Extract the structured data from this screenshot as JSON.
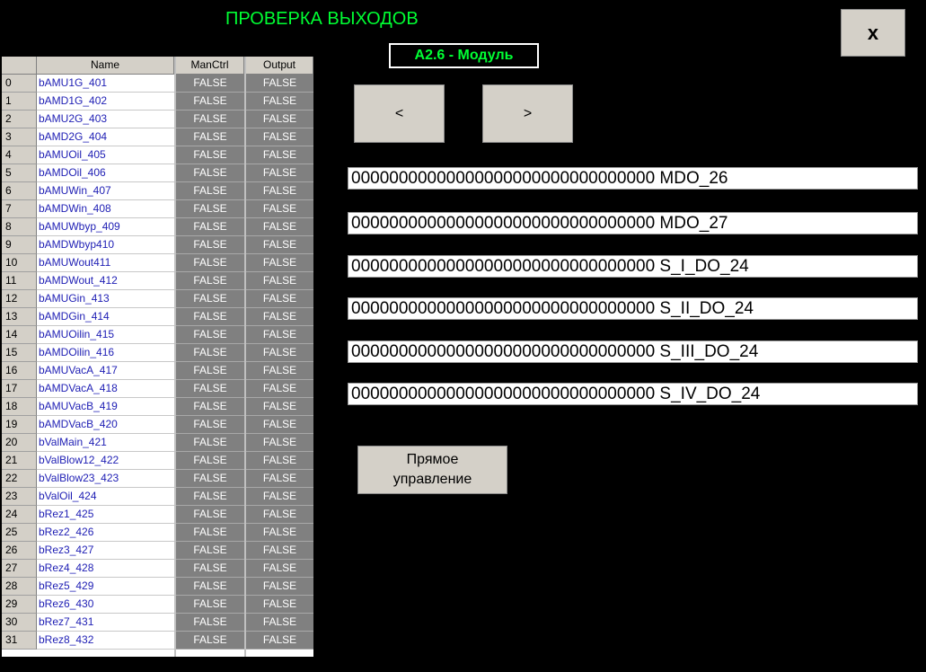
{
  "header": {
    "title": "ПРОВЕРКА ВЫХОДОВ",
    "close_label": "x"
  },
  "module": {
    "label": "A2.6 - Модуль"
  },
  "nav": {
    "prev_label": "<",
    "next_label": ">"
  },
  "table": {
    "columns": [
      "",
      "Name",
      "ManCtrl",
      "Output"
    ],
    "rows": [
      {
        "idx": "0",
        "name": "bAMU1G_401",
        "man": "FALSE",
        "out": "FALSE"
      },
      {
        "idx": "1",
        "name": "bAMD1G_402",
        "man": "FALSE",
        "out": "FALSE"
      },
      {
        "idx": "2",
        "name": "bAMU2G_403",
        "man": "FALSE",
        "out": "FALSE"
      },
      {
        "idx": "3",
        "name": "bAMD2G_404",
        "man": "FALSE",
        "out": "FALSE"
      },
      {
        "idx": "4",
        "name": "bAMUOil_405",
        "man": "FALSE",
        "out": "FALSE"
      },
      {
        "idx": "5",
        "name": "bAMDOil_406",
        "man": "FALSE",
        "out": "FALSE"
      },
      {
        "idx": "6",
        "name": "bAMUWin_407",
        "man": "FALSE",
        "out": "FALSE"
      },
      {
        "idx": "7",
        "name": "bAMDWin_408",
        "man": "FALSE",
        "out": "FALSE"
      },
      {
        "idx": "8",
        "name": "bAMUWbyp_409",
        "man": "FALSE",
        "out": "FALSE"
      },
      {
        "idx": "9",
        "name": "bAMDWbyp410",
        "man": "FALSE",
        "out": "FALSE"
      },
      {
        "idx": "10",
        "name": "bAMUWout411",
        "man": "FALSE",
        "out": "FALSE"
      },
      {
        "idx": "11",
        "name": "bAMDWout_412",
        "man": "FALSE",
        "out": "FALSE"
      },
      {
        "idx": "12",
        "name": "bAMUGin_413",
        "man": "FALSE",
        "out": "FALSE"
      },
      {
        "idx": "13",
        "name": "bAMDGin_414",
        "man": "FALSE",
        "out": "FALSE"
      },
      {
        "idx": "14",
        "name": "bAMUOilin_415",
        "man": "FALSE",
        "out": "FALSE"
      },
      {
        "idx": "15",
        "name": "bAMDOilin_416",
        "man": "FALSE",
        "out": "FALSE"
      },
      {
        "idx": "16",
        "name": "bAMUVacA_417",
        "man": "FALSE",
        "out": "FALSE"
      },
      {
        "idx": "17",
        "name": "bAMDVacA_418",
        "man": "FALSE",
        "out": "FALSE"
      },
      {
        "idx": "18",
        "name": "bAMUVacB_419",
        "man": "FALSE",
        "out": "FALSE"
      },
      {
        "idx": "19",
        "name": "bAMDVacB_420",
        "man": "FALSE",
        "out": "FALSE"
      },
      {
        "idx": "20",
        "name": "bValMain_421",
        "man": "FALSE",
        "out": "FALSE"
      },
      {
        "idx": "21",
        "name": "bValBlow12_422",
        "man": "FALSE",
        "out": "FALSE"
      },
      {
        "idx": "22",
        "name": "bValBlow23_423",
        "man": "FALSE",
        "out": "FALSE"
      },
      {
        "idx": "23",
        "name": "bValOil_424",
        "man": "FALSE",
        "out": "FALSE"
      },
      {
        "idx": "24",
        "name": "bRez1_425",
        "man": "FALSE",
        "out": "FALSE"
      },
      {
        "idx": "25",
        "name": "bRez2_426",
        "man": "FALSE",
        "out": "FALSE"
      },
      {
        "idx": "26",
        "name": "bRez3_427",
        "man": "FALSE",
        "out": "FALSE"
      },
      {
        "idx": "27",
        "name": "bRez4_428",
        "man": "FALSE",
        "out": "FALSE"
      },
      {
        "idx": "28",
        "name": "bRez5_429",
        "man": "FALSE",
        "out": "FALSE"
      },
      {
        "idx": "29",
        "name": "bRez6_430",
        "man": "FALSE",
        "out": "FALSE"
      },
      {
        "idx": "30",
        "name": "bRez7_431",
        "man": "FALSE",
        "out": "FALSE"
      },
      {
        "idx": "31",
        "name": "bRez8_432",
        "man": "FALSE",
        "out": "FALSE"
      }
    ]
  },
  "bitfields": [
    "00000000000000000000000000000000 MDO_26",
    "00000000000000000000000000000000 MDO_27",
    "00000000000000000000000000000000 S_I_DO_24",
    "00000000000000000000000000000000 S_II_DO_24",
    "00000000000000000000000000000000 S_III_DO_24",
    "00000000000000000000000000000000 S_IV_DO_24"
  ],
  "direct_control": {
    "label": "Прямое\nуправление"
  },
  "colors": {
    "background": "#000000",
    "title": "#00ff33",
    "button": "#d4d0c8",
    "name_text": "#1e1eb4",
    "value_cell": "#808080"
  }
}
